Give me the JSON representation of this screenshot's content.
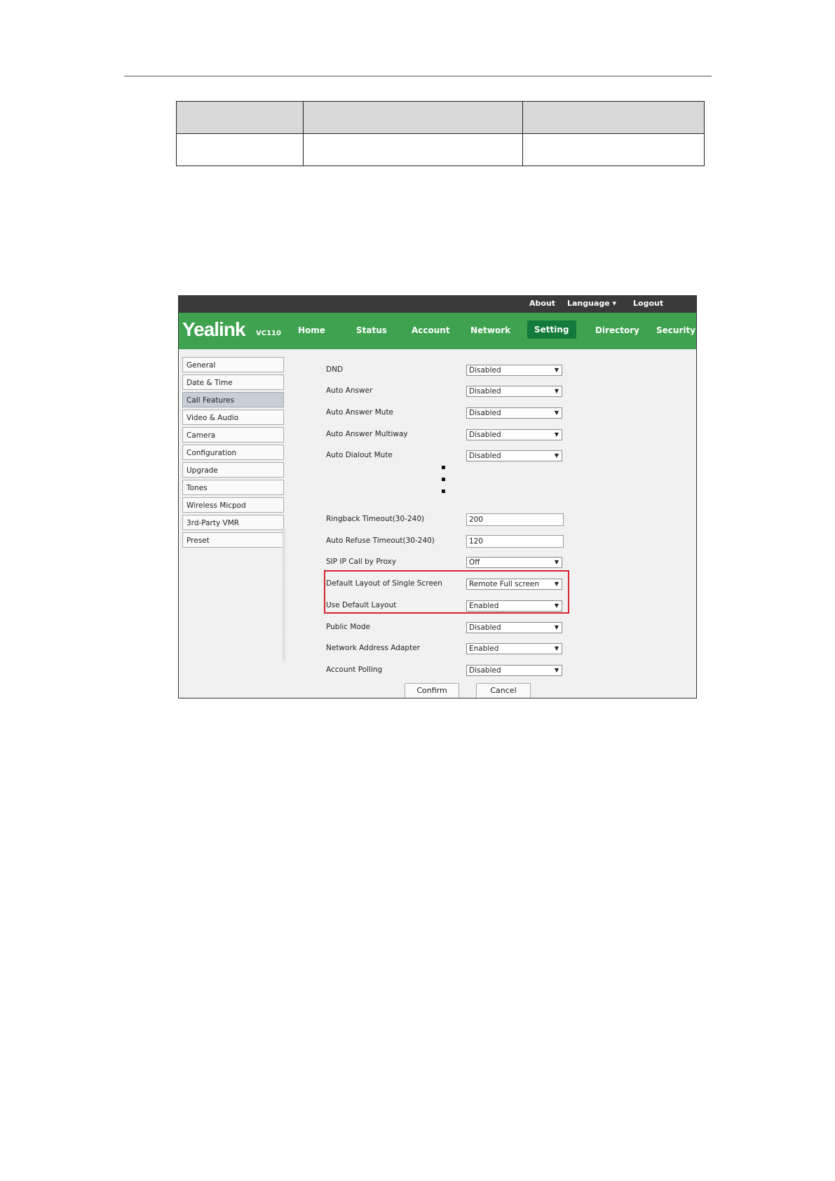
{
  "topbar": {
    "about": "About",
    "language": "Language ▾",
    "logout": "Logout"
  },
  "brand": {
    "logo": "Yealink",
    "model": "VC110"
  },
  "nav": [
    "Home",
    "Status",
    "Account",
    "Network",
    "Setting",
    "Directory",
    "Security"
  ],
  "sidebar": [
    "General",
    "Date & Time",
    "Call Features",
    "Video & Audio",
    "Camera",
    "Configuration",
    "Upgrade",
    "Tones",
    "Wireless Micpod",
    "3rd-Party VMR",
    "Preset"
  ],
  "fields": {
    "dnd": {
      "label": "DND",
      "value": "Disabled"
    },
    "auto_answer": {
      "label": "Auto Answer",
      "value": "Disabled"
    },
    "auto_answer_mute": {
      "label": "Auto Answer Mute",
      "value": "Disabled"
    },
    "auto_answer_multiway": {
      "label": "Auto Answer Multiway",
      "value": "Disabled"
    },
    "auto_dialout_mute": {
      "label": "Auto Dialout Mute",
      "value": "Disabled"
    },
    "ringback_timeout": {
      "label": "Ringback Timeout(30-240)",
      "value": "200"
    },
    "auto_refuse_timeout": {
      "label": "Auto Refuse Timeout(30-240)",
      "value": "120"
    },
    "sip_ip_call_by_proxy": {
      "label": "SIP IP Call by Proxy",
      "value": "Off"
    },
    "default_layout_single_screen": {
      "label": "Default Layout of Single Screen",
      "value": "Remote Full screen"
    },
    "use_default_layout": {
      "label": "Use Default Layout",
      "value": "Enabled"
    },
    "public_mode": {
      "label": "Public Mode",
      "value": "Disabled"
    },
    "network_address_adapter": {
      "label": "Network Address Adapter",
      "value": "Enabled"
    },
    "account_polling": {
      "label": "Account Polling",
      "value": "Disabled"
    }
  },
  "buttons": {
    "confirm": "Confirm",
    "cancel": "Cancel"
  },
  "colors": {
    "nav_green": "#3ea24f",
    "active_tab": "#127a3a",
    "highlight": "#d9232e",
    "topbar": "#3a3a3a"
  }
}
